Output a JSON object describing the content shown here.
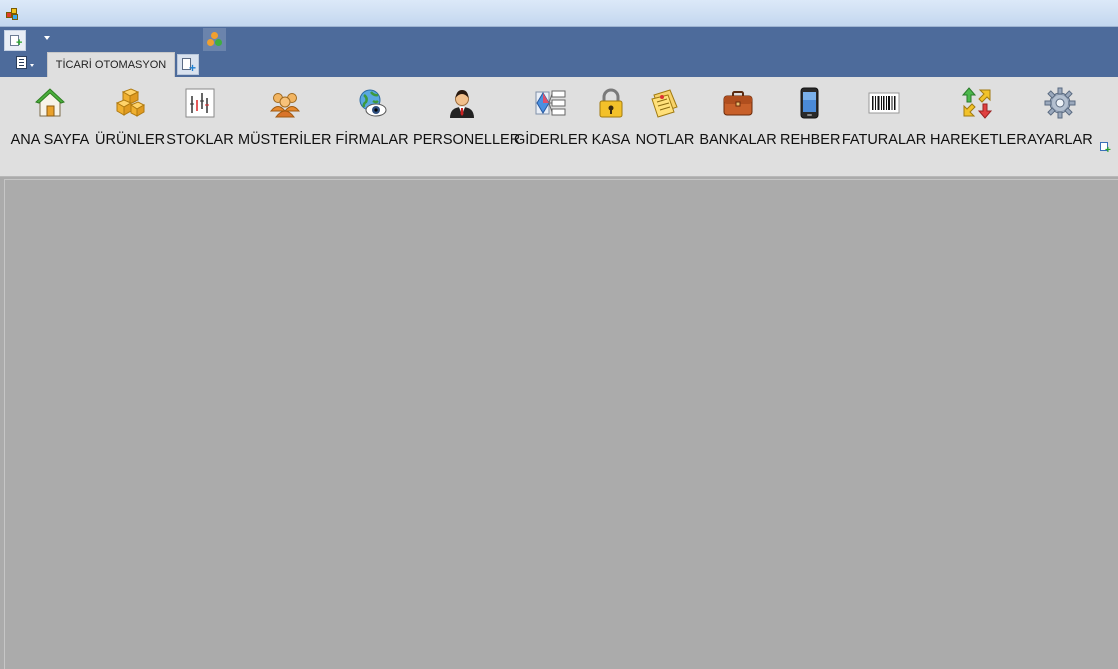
{
  "window": {
    "app_icon": "app-logo-icon"
  },
  "quick_access": {
    "new_icon": "new-document-icon",
    "customize_icon": "dropdown-arrow-icon",
    "extra_icon": "colored-dots-icon"
  },
  "ribbon": {
    "menu_icon": "application-menu-icon",
    "tabs": [
      {
        "label": "TİCARİ OTOMASYON",
        "active": true
      }
    ],
    "add_tab_icon": "add-page-icon",
    "buttons": [
      {
        "label": "ANA SAYFA",
        "icon": "home-icon"
      },
      {
        "label": "ÜRÜNLER",
        "icon": "boxes-icon"
      },
      {
        "label": "STOKLAR",
        "icon": "chart-bars-icon"
      },
      {
        "label": "MÜSTERİLER",
        "icon": "users-icon"
      },
      {
        "label": "FİRMALAR",
        "icon": "globe-eye-icon"
      },
      {
        "label": "PERSONELLER",
        "icon": "person-icon"
      },
      {
        "label": "GİDERLER",
        "icon": "diagram-icon"
      },
      {
        "label": "KASA",
        "icon": "lock-icon"
      },
      {
        "label": "NOTLAR",
        "icon": "notes-icon"
      },
      {
        "label": "BANKALAR",
        "icon": "briefcase-icon"
      },
      {
        "label": "REHBER",
        "icon": "phone-icon"
      },
      {
        "label": "FATURALAR",
        "icon": "barcode-icon"
      },
      {
        "label": "HAREKETLER",
        "icon": "arrows-icon"
      },
      {
        "label": "AYARLAR",
        "icon": "gear-icon"
      }
    ],
    "corner_icon": "add-page-icon"
  },
  "colors": {
    "ribbon_band": "#4d6b9b",
    "ribbon_body": "#dfdfdf",
    "workspace": "#ababab"
  }
}
